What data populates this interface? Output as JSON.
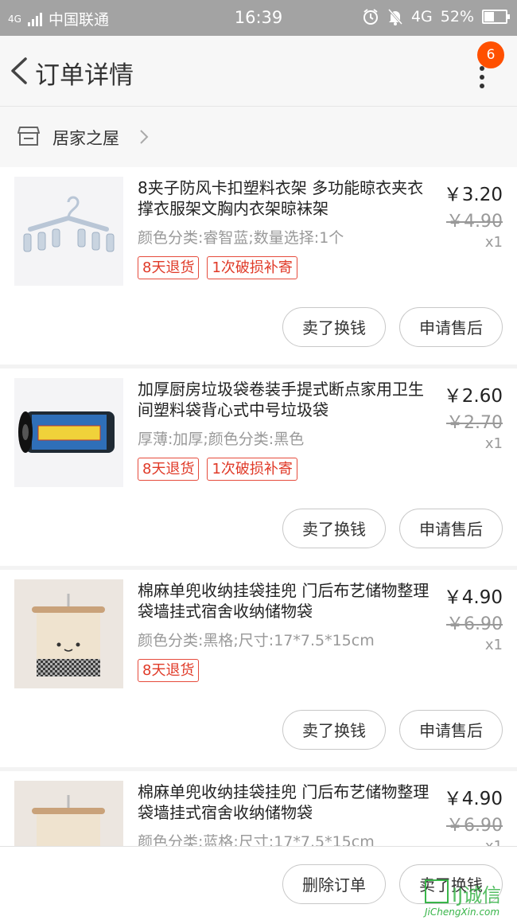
{
  "status_bar": {
    "network_label": "4G",
    "carrier": "中国联通",
    "time": "16:39",
    "data_type": "4G",
    "battery": "52%",
    "battery_level": 0.52
  },
  "header": {
    "title": "订单详情",
    "notification_count": "6",
    "icons": [
      "back-arrow-icon",
      "more-vertical-icon"
    ]
  },
  "shop": {
    "name": "居家之屋",
    "icon": "store-icon"
  },
  "products": [
    {
      "title": "8夹子防风卡扣塑料衣架 多功能晾衣夹衣撑衣服架文胸内衣架晾袜架",
      "spec": "颜色分类:睿智蓝;数量选择:1个",
      "price": "￥3.20",
      "original_price": "￥4.90",
      "quantity": "x1",
      "tags": [
        "8天退货",
        "1次破损补寄"
      ],
      "actions": [
        "卖了换钱",
        "申请售后"
      ]
    },
    {
      "title": "加厚厨房垃圾袋卷装手提式断点家用卫生间塑料袋背心式中号垃圾袋",
      "spec": "厚薄:加厚;颜色分类:黑色",
      "price": "￥2.60",
      "original_price": "￥2.70",
      "quantity": "x1",
      "tags": [
        "8天退货",
        "1次破损补寄"
      ],
      "actions": [
        "卖了换钱",
        "申请售后"
      ]
    },
    {
      "title": "棉麻单兜收纳挂袋挂兜 门后布艺储物整理袋墙挂式宿舍收纳储物袋",
      "spec": "颜色分类:黑格;尺寸:17*7.5*15cm",
      "price": "￥4.90",
      "original_price": "￥6.90",
      "quantity": "x1",
      "tags": [
        "8天退货"
      ],
      "actions": [
        "卖了换钱",
        "申请售后"
      ]
    },
    {
      "title": "棉麻单兜收纳挂袋挂兜 门后布艺储物整理袋墙挂式宿舍收纳储物袋",
      "spec": "颜色分类:蓝格;尺寸:17*7.5*15cm",
      "price": "￥4.90",
      "original_price": "￥6.90",
      "quantity": "x1"
    }
  ],
  "bottom_bar": {
    "delete_label": "删除订单",
    "sell_label": "卖了换钱"
  },
  "watermark": {
    "text": "IJ诚信",
    "url_text": "JiChengXin.com"
  },
  "colors": {
    "accent": "#ff5000",
    "tag_red": "#e03a28",
    "status_bar": "#a3a3a3"
  }
}
